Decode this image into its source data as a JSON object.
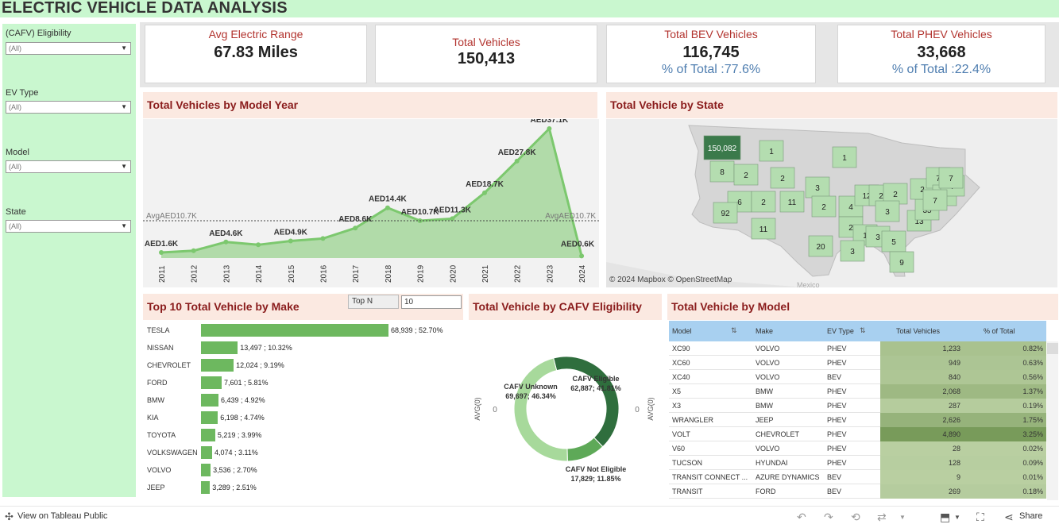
{
  "dashboard": {
    "title": "ELECTRIC VEHICLE DATA  ANALYSIS"
  },
  "filters": [
    {
      "label": "(CAFV) Eligibility",
      "value": "(All)"
    },
    {
      "label": "EV Type",
      "value": "(All)"
    },
    {
      "label": "Model",
      "value": "(All)"
    },
    {
      "label": "State",
      "value": "(All)"
    }
  ],
  "kpis": {
    "avg_range": {
      "label": "Avg Electric Range",
      "value": "67.83 Miles"
    },
    "total_vehicles": {
      "label": "Total Vehicles",
      "value": "150,413"
    },
    "bev": {
      "label": "Total BEV Vehicles",
      "value": "116,745",
      "pct": "% of Total :77.6%"
    },
    "phev": {
      "label": "Total PHEV Vehicles",
      "value": "33,668",
      "pct": "% of Total :22.4%"
    }
  },
  "sections": {
    "model_year": "Total Vehicles by Model Year",
    "state": "Total Vehicle by State",
    "make": "Top 10 Total Vehicle by Make",
    "cafv": "Total Vehicle by CAFV Eligibility",
    "model": "Total Vehicle by Model"
  },
  "topn": {
    "label": "Top N",
    "value": "10"
  },
  "chart_data": [
    {
      "type": "area",
      "x": [
        "2011",
        "2012",
        "2013",
        "2014",
        "2015",
        "2016",
        "2017",
        "2018",
        "2019",
        "2020",
        "2021",
        "2022",
        "2023",
        "2024"
      ],
      "values": [
        1.6,
        2.1,
        4.6,
        3.8,
        4.9,
        5.6,
        8.6,
        14.4,
        10.7,
        11.3,
        18.7,
        27.8,
        37.1,
        0.6
      ],
      "data_labels": [
        "AED1.6K",
        "",
        "AED4.6K",
        "",
        "AED4.9K",
        "",
        "AED8.6K",
        "AED14.4K",
        "AED10.7K",
        "AED11.3K",
        "AED18.7K",
        "AED27.8K",
        "AED37.1K",
        "AED0.6K"
      ],
      "avg_line": 10.7,
      "avg_labels": [
        "AvgAED10.7K",
        "AvgAED10.7K"
      ],
      "ylim": [
        0,
        37.1
      ],
      "color": "#7cc86e"
    },
    {
      "type": "bar",
      "categories": [
        "TESLA",
        "NISSAN",
        "CHEVROLET",
        "FORD",
        "BMW",
        "KIA",
        "TOYOTA",
        "VOLKSWAGEN",
        "VOLVO",
        "JEEP"
      ],
      "values": [
        68939,
        13497,
        12024,
        7601,
        6439,
        6198,
        5219,
        4074,
        3536,
        3289
      ],
      "labels": [
        "68,939 ; 52.70%",
        "13,497 ; 10.32%",
        "12,024 ; 9.19%",
        "7,601 ; 5.81%",
        "6,439 ; 4.92%",
        "6,198 ; 4.74%",
        "5,219 ; 3.99%",
        "4,074 ; 3.11%",
        "3,536 ; 2.70%",
        "3,289 ; 2.51%"
      ],
      "color": "#6db85f"
    },
    {
      "type": "pie",
      "slices": [
        {
          "name": "CAFV Eligible",
          "value": 62887,
          "label": "CAFV Eligible\n62,887; 41.81%",
          "color": "#2f6e3d"
        },
        {
          "name": "CAFV Not Eligible",
          "value": 17829,
          "label": "CAFV Not Eligible\n17,829; 11.85%",
          "color": "#5ea958"
        },
        {
          "name": "CAFV Unknown",
          "value": 69697,
          "label": "CAFV Unknown\n69,697; 46.34%",
          "color": "#a7d99b"
        }
      ],
      "axis_labels": [
        "AVG(0)",
        "AVG(0)"
      ],
      "axis_ticks": [
        "0",
        "0"
      ]
    },
    {
      "type": "table",
      "columns": [
        "Model",
        "Make",
        "EV Type",
        "Total Vehicles",
        "% of Total"
      ],
      "rows": [
        [
          "XC90",
          "VOLVO",
          "PHEV",
          "1,233",
          "0.82%"
        ],
        [
          "XC60",
          "VOLVO",
          "PHEV",
          "949",
          "0.63%"
        ],
        [
          "XC40",
          "VOLVO",
          "BEV",
          "840",
          "0.56%"
        ],
        [
          "X5",
          "BMW",
          "PHEV",
          "2,068",
          "1.37%"
        ],
        [
          "X3",
          "BMW",
          "PHEV",
          "287",
          "0.19%"
        ],
        [
          "WRANGLER",
          "JEEP",
          "PHEV",
          "2,626",
          "1.75%"
        ],
        [
          "VOLT",
          "CHEVROLET",
          "PHEV",
          "4,890",
          "3.25%"
        ],
        [
          "V60",
          "VOLVO",
          "PHEV",
          "28",
          "0.02%"
        ],
        [
          "TUCSON",
          "HYUNDAI",
          "PHEV",
          "128",
          "0.09%"
        ],
        [
          "TRANSIT CONNECT ...",
          "AZURE DYNAMICS",
          "BEV",
          "9",
          "0.01%"
        ],
        [
          "TRANSIT",
          "FORD",
          "BEV",
          "269",
          "0.18%"
        ]
      ],
      "row_values": [
        1233,
        949,
        840,
        2068,
        287,
        2626,
        4890,
        28,
        128,
        9,
        269
      ]
    }
  ],
  "map": {
    "state_values": [
      {
        "state": "WA",
        "value": "150,082"
      },
      {
        "state": "OR",
        "value": "8"
      },
      {
        "state": "ID",
        "value": "2"
      },
      {
        "state": "MT",
        "value": "1"
      },
      {
        "state": "WY",
        "value": "2"
      },
      {
        "state": "ND",
        "value": "1"
      },
      {
        "state": "NV",
        "value": "6"
      },
      {
        "state": "CA",
        "value": "92"
      },
      {
        "state": "UT",
        "value": "2"
      },
      {
        "state": "AZ",
        "value": "11"
      },
      {
        "state": "CO",
        "value": "11"
      },
      {
        "state": "NE",
        "value": "3"
      },
      {
        "state": "KS",
        "value": "2"
      },
      {
        "state": "TX",
        "value": "20"
      },
      {
        "state": "MO",
        "value": "4"
      },
      {
        "state": "IL",
        "value": "12"
      },
      {
        "state": "IN",
        "value": "2"
      },
      {
        "state": "OH",
        "value": "2"
      },
      {
        "state": "KY",
        "value": "3"
      },
      {
        "state": "AR",
        "value": "2"
      },
      {
        "state": "MS",
        "value": "1"
      },
      {
        "state": "AL",
        "value": "3"
      },
      {
        "state": "LA",
        "value": "3"
      },
      {
        "state": "GA",
        "value": "5"
      },
      {
        "state": "FL",
        "value": "9"
      },
      {
        "state": "NC",
        "value": "13"
      },
      {
        "state": "VA",
        "value": "35"
      },
      {
        "state": "PA",
        "value": "2"
      },
      {
        "state": "NY",
        "value": "7"
      },
      {
        "state": "NJ",
        "value": "9"
      },
      {
        "state": "CT",
        "value": "7"
      },
      {
        "state": "VT",
        "value": "7"
      },
      {
        "state": "MD",
        "value": "7"
      }
    ],
    "attribution": "© 2024 Mapbox  © OpenStreetMap",
    "place_label": "Mexico"
  },
  "footer": {
    "view_link": "View on Tableau Public",
    "share": "Share"
  }
}
